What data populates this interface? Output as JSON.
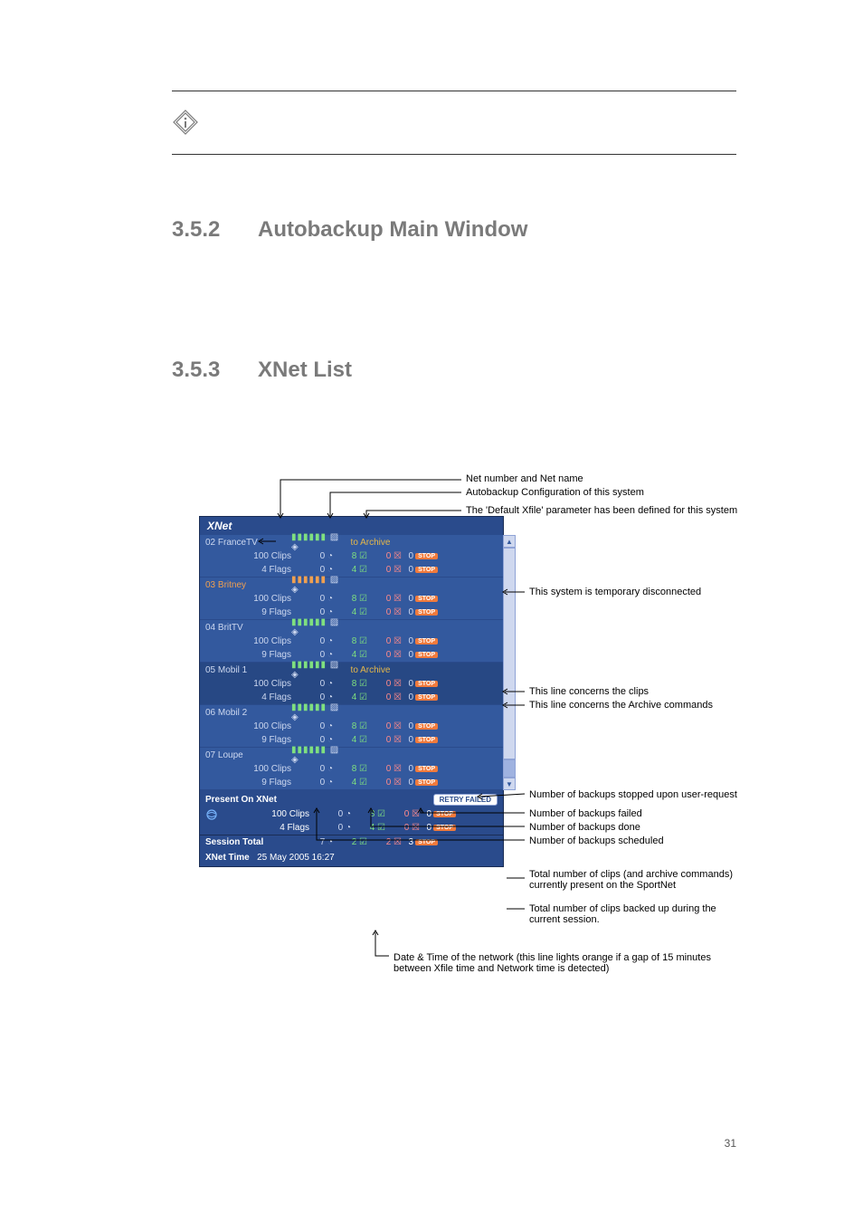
{
  "note": "",
  "section352_num": "3.5.2",
  "section352_title": "Autobackup Main Window",
  "body352": "",
  "section353_num": "3.5.3",
  "section353_title": "XNet List",
  "body353": "",
  "panel_title": "XNet",
  "to_archive": "to Archive",
  "systems": [
    {
      "id": "02",
      "name": "FranceTV",
      "toArchive": true,
      "disc": false,
      "clips": {
        "n": "100",
        "s": "0",
        "d": "8",
        "f": "0",
        "st": "0"
      },
      "flags": {
        "n": "4",
        "s": "0",
        "d": "4",
        "f": "0",
        "st": "0"
      }
    },
    {
      "id": "03",
      "name": "Britney",
      "toArchive": false,
      "disc": true,
      "clips": {
        "n": "100",
        "s": "0",
        "d": "8",
        "f": "0",
        "st": "0"
      },
      "flags": {
        "n": "9",
        "s": "0",
        "d": "4",
        "f": "0",
        "st": "0"
      }
    },
    {
      "id": "04",
      "name": "BritTV",
      "toArchive": false,
      "disc": false,
      "clips": {
        "n": "100",
        "s": "0",
        "d": "8",
        "f": "0",
        "st": "0"
      },
      "flags": {
        "n": "9",
        "s": "0",
        "d": "4",
        "f": "0",
        "st": "0"
      }
    },
    {
      "id": "05",
      "name": "Mobil 1",
      "toArchive": true,
      "disc": false,
      "sel": true,
      "clips": {
        "n": "100",
        "s": "0",
        "d": "8",
        "f": "0",
        "st": "0"
      },
      "flags": {
        "n": "4",
        "s": "0",
        "d": "4",
        "f": "0",
        "st": "0"
      }
    },
    {
      "id": "06",
      "name": "Mobil 2",
      "toArchive": false,
      "disc": false,
      "clips": {
        "n": "100",
        "s": "0",
        "d": "8",
        "f": "0",
        "st": "0"
      },
      "flags": {
        "n": "9",
        "s": "0",
        "d": "4",
        "f": "0",
        "st": "0"
      }
    },
    {
      "id": "07",
      "name": "Loupe",
      "toArchive": false,
      "disc": false,
      "clips": {
        "n": "100",
        "s": "0",
        "d": "8",
        "f": "0",
        "st": "0"
      },
      "flags": {
        "n": "9",
        "s": "0",
        "d": "4",
        "f": "0",
        "st": "0"
      }
    }
  ],
  "clips_label": "Clips",
  "flags_label": "Flags",
  "present_title": "Present On XNet",
  "retry_label": "RETRY FAILED",
  "present_clips": {
    "n": "100",
    "s": "0",
    "d": "8",
    "f": "0",
    "st": "0"
  },
  "present_flags": {
    "n": "4",
    "s": "0",
    "d": "4",
    "f": "0",
    "st": "0"
  },
  "session_title": "Session Total",
  "session": {
    "s": "7",
    "d": "2",
    "f": "2",
    "st": "3"
  },
  "xnet_time_label": "XNet Time",
  "xnet_time": "25 May 2005  16:27",
  "stop_text": "STOP",
  "callout": {
    "net": "Net number and Net name",
    "cfg": "Autobackup Configuration of this system",
    "defx": "The 'Default Xfile' parameter has been defined for this system",
    "disc": "This system is temporary disconnected",
    "clipline": "This line concerns the clips",
    "arcline": "This line concerns the Archive commands",
    "nstop": "Number of backups stopped upon user-request",
    "nfail": "Number of backups failed",
    "ndone": "Number of backups done",
    "nsched": "Number of backups scheduled",
    "totclips": "Total number of clips (and archive commands) currently present on the SportNet",
    "totsess": "Total number of clips backed up during the current session.",
    "dtime": "Date & Time of the network (this line lights orange  if a gap of 15 minutes between Xfile time and Network time  is detected)"
  },
  "page_num": "31"
}
